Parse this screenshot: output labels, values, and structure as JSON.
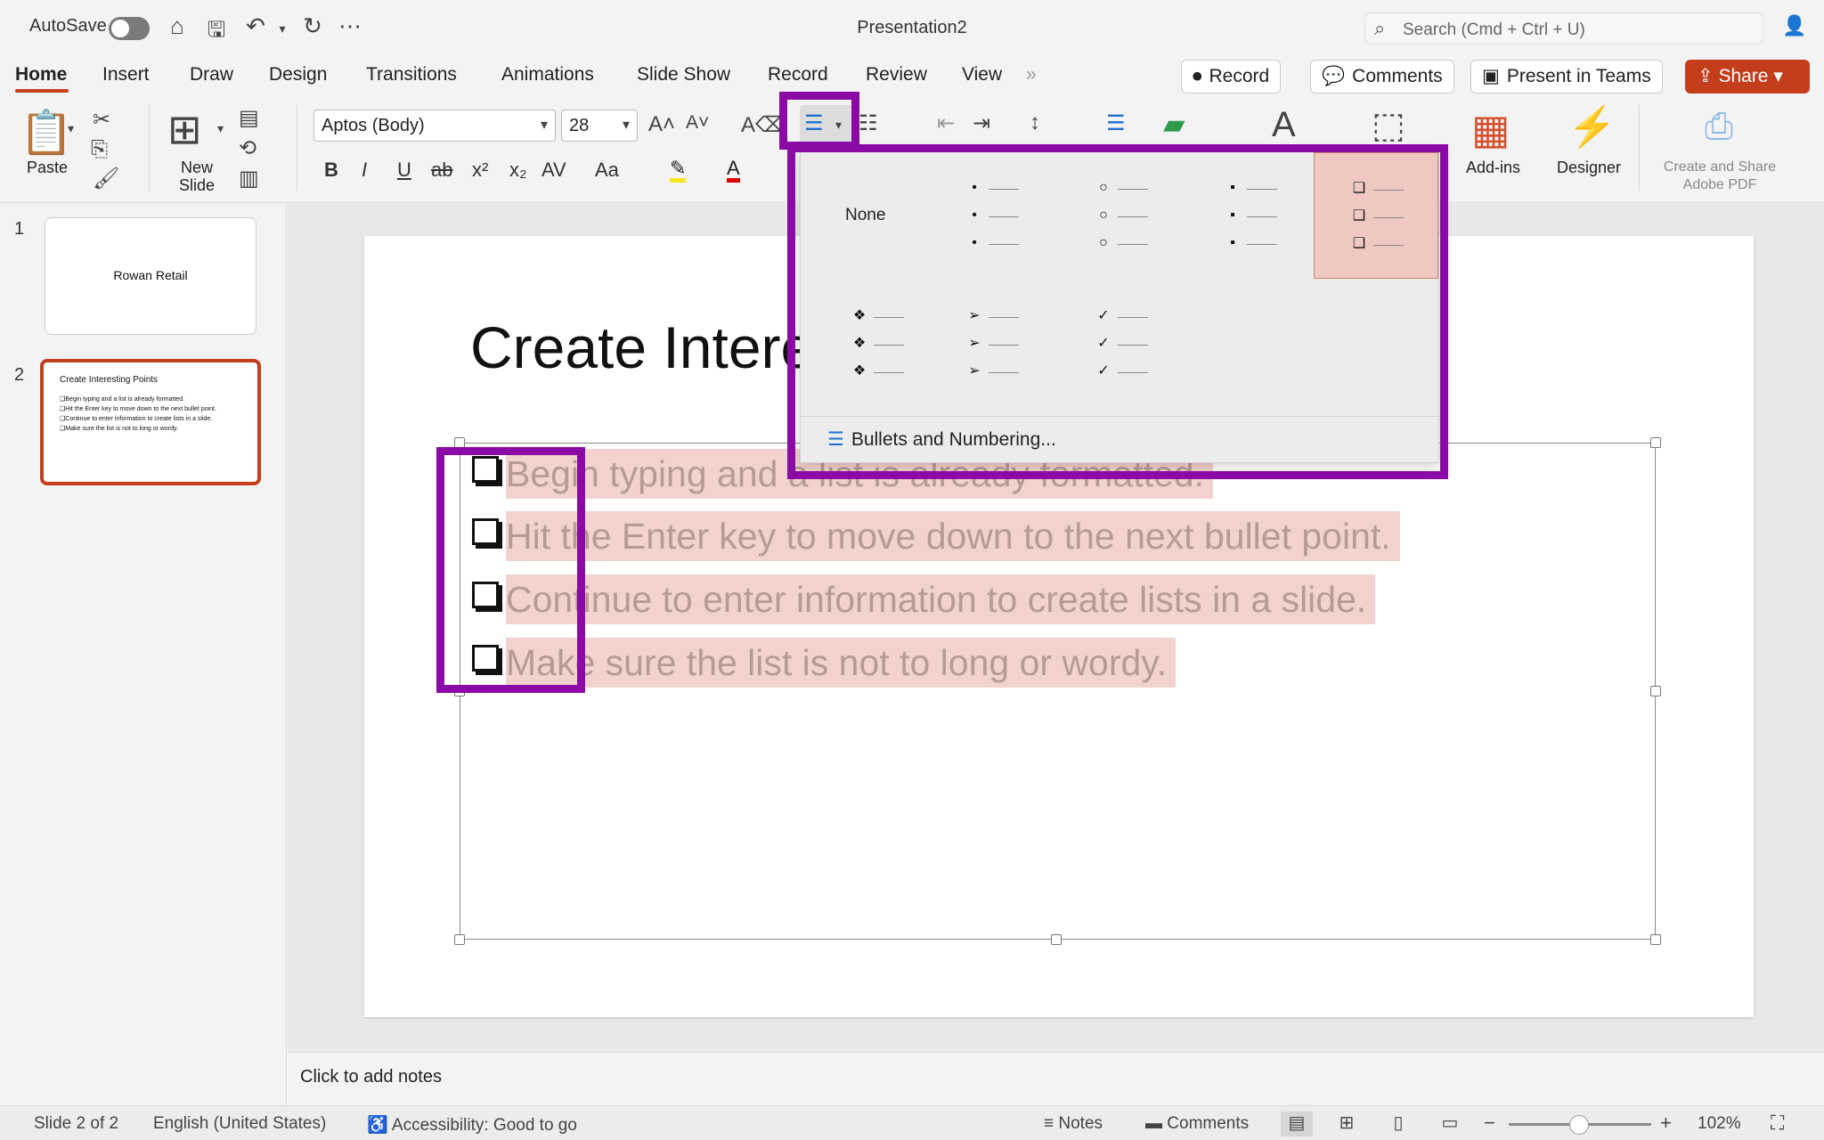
{
  "titlebar": {
    "autosave_label": "AutoSave",
    "doc_title": "Presentation2",
    "search_placeholder": "Search (Cmd + Ctrl + U)",
    "icons": [
      "home-icon",
      "save-icon",
      "undo-icon",
      "redo-icon",
      "more-icon",
      "person-icon"
    ]
  },
  "tabs": [
    {
      "label": "Home",
      "active": true
    },
    {
      "label": "Insert"
    },
    {
      "label": "Draw"
    },
    {
      "label": "Design"
    },
    {
      "label": "Transitions"
    },
    {
      "label": "Animations"
    },
    {
      "label": "Slide Show"
    },
    {
      "label": "Record"
    },
    {
      "label": "Review"
    },
    {
      "label": "View"
    }
  ],
  "actions": {
    "record": "Record",
    "comments": "Comments",
    "present": "Present in Teams",
    "share": "Share"
  },
  "ribbon": {
    "paste": "Paste",
    "new_slide": "New Slide",
    "font_name": "Aptos (Body)",
    "font_size": "28",
    "addins": "Add-ins",
    "designer": "Designer",
    "create_pdf": "Create and Share Adobe PDF",
    "format_buttons": [
      "B",
      "I",
      "U",
      "ab",
      "x²",
      "x₂",
      "AV",
      "Aa"
    ]
  },
  "slides": [
    {
      "num": "1",
      "title": "Rowan Retail"
    },
    {
      "num": "2",
      "title": "Create Interesting Points",
      "selected": true,
      "lines": [
        "❑Begin typing and a list is already formatted.",
        "❑Hit the Enter key to move down to the next bullet point.",
        "❑Continue to enter information to create lists in a slide.",
        "❑Make sure the list is not to long or wordy."
      ]
    }
  ],
  "current_slide": {
    "title": "Create Intere",
    "bullets": [
      "Begin typing and a list is already formatted.",
      "Hit the Enter key to move down to the next bullet point.",
      "Continue to enter information to create lists in a slide.",
      "Make sure the list is not to long or wordy."
    ]
  },
  "bullet_menu": {
    "none_label": "None",
    "options": [
      {
        "glyph": "•",
        "name": "small-dot"
      },
      {
        "glyph": "○",
        "name": "hollow-circle"
      },
      {
        "glyph": "▪",
        "name": "square"
      },
      {
        "glyph": "❑",
        "name": "hollow-square",
        "selected": true
      },
      {
        "glyph": "❖",
        "name": "diamond"
      },
      {
        "glyph": "➢",
        "name": "arrow"
      },
      {
        "glyph": "✓",
        "name": "checkmark"
      }
    ],
    "more_label": "Bullets and Numbering..."
  },
  "notes_placeholder": "Click to add notes",
  "status": {
    "slide": "Slide 2 of 2",
    "language": "English (United States)",
    "accessibility": "Accessibility: Good to go",
    "notes": "Notes",
    "comments": "Comments",
    "zoom": "102%"
  },
  "colors": {
    "accent": "#c43e1c",
    "highlight": "#8b0aa5",
    "selection": "#f2d2cc"
  }
}
